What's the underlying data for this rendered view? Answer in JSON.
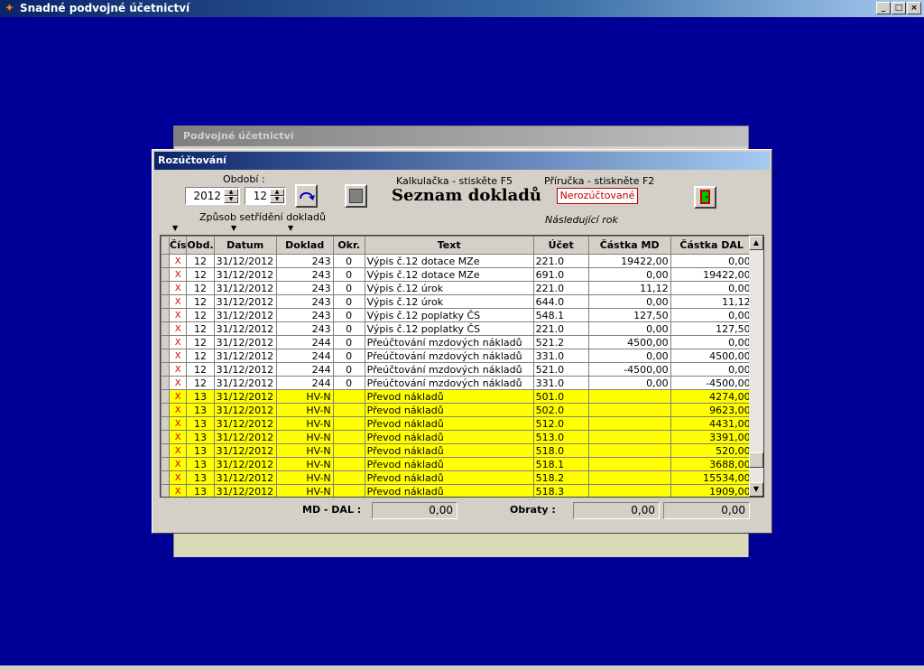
{
  "app": {
    "title": "Snadné podvojné účetnictví"
  },
  "back_window": {
    "title": "Podvojné účetnictví"
  },
  "dialog": {
    "title": "Rozúčtování",
    "obdobi_label": "Období :",
    "year": "2012",
    "month": "12",
    "calc_hint": "Kalkulačka - stiskěte F5",
    "manual_hint": "Příručka - stiskněte F2",
    "heading": "Seznam dokladů",
    "status_badge": "Nerozúčtované",
    "sort_label": "Způsob setřídění dokladů",
    "next_year": "Následující rok"
  },
  "table": {
    "columns": [
      "Čís",
      "Obd.",
      "Datum",
      "Doklad",
      "Okr.",
      "Text",
      "Účet",
      "Částka MD",
      "Částka DAL"
    ],
    "rows": [
      {
        "mark": "X",
        "obd": "12",
        "datum": "31/12/2012",
        "doklad": "243",
        "okr": "0",
        "text": "Výpis č.12 dotace MZe",
        "ucet": "221.0",
        "md": "19422,00",
        "dal": "0,00",
        "hl": false
      },
      {
        "mark": "X",
        "obd": "12",
        "datum": "31/12/2012",
        "doklad": "243",
        "okr": "0",
        "text": "Výpis č.12 dotace MZe",
        "ucet": "691.0",
        "md": "0,00",
        "dal": "19422,00",
        "hl": false
      },
      {
        "mark": "X",
        "obd": "12",
        "datum": "31/12/2012",
        "doklad": "243",
        "okr": "0",
        "text": "Výpis č.12 úrok",
        "ucet": "221.0",
        "md": "11,12",
        "dal": "0,00",
        "hl": false
      },
      {
        "mark": "X",
        "obd": "12",
        "datum": "31/12/2012",
        "doklad": "243",
        "okr": "0",
        "text": "Výpis č.12 úrok",
        "ucet": "644.0",
        "md": "0,00",
        "dal": "11,12",
        "hl": false
      },
      {
        "mark": "X",
        "obd": "12",
        "datum": "31/12/2012",
        "doklad": "243",
        "okr": "0",
        "text": "Výpis č.12 poplatky ČS",
        "ucet": "548.1",
        "md": "127,50",
        "dal": "0,00",
        "hl": false
      },
      {
        "mark": "X",
        "obd": "12",
        "datum": "31/12/2012",
        "doklad": "243",
        "okr": "0",
        "text": "Výpis č.12 poplatky ČS",
        "ucet": "221.0",
        "md": "0,00",
        "dal": "127,50",
        "hl": false
      },
      {
        "mark": "X",
        "obd": "12",
        "datum": "31/12/2012",
        "doklad": "244",
        "okr": "0",
        "text": "Přeúčtování mzdových nákladů",
        "ucet": "521.2",
        "md": "4500,00",
        "dal": "0,00",
        "hl": false
      },
      {
        "mark": "X",
        "obd": "12",
        "datum": "31/12/2012",
        "doklad": "244",
        "okr": "0",
        "text": "Přeúčtování mzdových nákladů",
        "ucet": "331.0",
        "md": "0,00",
        "dal": "4500,00",
        "hl": false
      },
      {
        "mark": "X",
        "obd": "12",
        "datum": "31/12/2012",
        "doklad": "244",
        "okr": "0",
        "text": "Přeúčtování mzdových nákladů",
        "ucet": "521.0",
        "md": "-4500,00",
        "dal": "0,00",
        "hl": false
      },
      {
        "mark": "X",
        "obd": "12",
        "datum": "31/12/2012",
        "doklad": "244",
        "okr": "0",
        "text": "Přeúčtování mzdových nákladů",
        "ucet": "331.0",
        "md": "0,00",
        "dal": "-4500,00",
        "hl": false
      },
      {
        "mark": "X",
        "obd": "13",
        "datum": "31/12/2012",
        "doklad": "HV-N",
        "okr": "",
        "text": "Převod nákladů",
        "ucet": "501.0",
        "md": "",
        "dal": "4274,00",
        "hl": true
      },
      {
        "mark": "X",
        "obd": "13",
        "datum": "31/12/2012",
        "doklad": "HV-N",
        "okr": "",
        "text": "Převod nákladů",
        "ucet": "502.0",
        "md": "",
        "dal": "9623,00",
        "hl": true
      },
      {
        "mark": "X",
        "obd": "13",
        "datum": "31/12/2012",
        "doklad": "HV-N",
        "okr": "",
        "text": "Převod nákladů",
        "ucet": "512.0",
        "md": "",
        "dal": "4431,00",
        "hl": true
      },
      {
        "mark": "X",
        "obd": "13",
        "datum": "31/12/2012",
        "doklad": "HV-N",
        "okr": "",
        "text": "Převod nákladů",
        "ucet": "513.0",
        "md": "",
        "dal": "3391,00",
        "hl": true
      },
      {
        "mark": "X",
        "obd": "13",
        "datum": "31/12/2012",
        "doklad": "HV-N",
        "okr": "",
        "text": "Převod nákladů",
        "ucet": "518.0",
        "md": "",
        "dal": "520,00",
        "hl": true
      },
      {
        "mark": "X",
        "obd": "13",
        "datum": "31/12/2012",
        "doklad": "HV-N",
        "okr": "",
        "text": "Převod nákladů",
        "ucet": "518.1",
        "md": "",
        "dal": "3688,00",
        "hl": true
      },
      {
        "mark": "X",
        "obd": "13",
        "datum": "31/12/2012",
        "doklad": "HV-N",
        "okr": "",
        "text": "Převod nákladů",
        "ucet": "518.2",
        "md": "",
        "dal": "15534,00",
        "hl": true
      },
      {
        "mark": "X",
        "obd": "13",
        "datum": "31/12/2012",
        "doklad": "HV-N",
        "okr": "",
        "text": "Převod nákladů",
        "ucet": "518.3",
        "md": "",
        "dal": "1909,00",
        "hl": true
      }
    ]
  },
  "footer": {
    "md_dal_label": "MD - DAL :",
    "md_dal_value": "0,00",
    "obraty_label": "Obraty :",
    "obraty_md": "0,00",
    "obraty_dal": "0,00"
  }
}
